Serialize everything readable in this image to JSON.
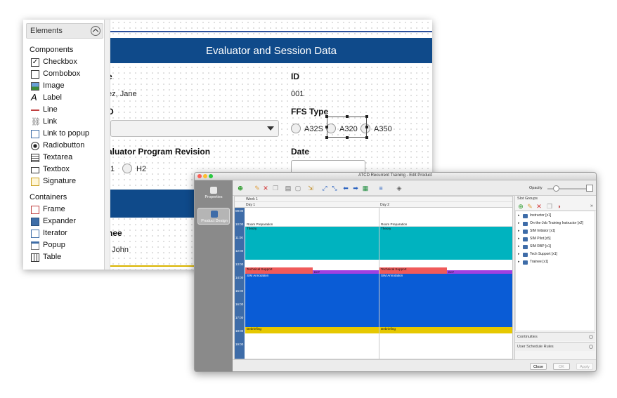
{
  "designer": {
    "palette": {
      "title": "Elements",
      "components_title": "Components",
      "components": [
        {
          "label": "Checkbox",
          "icon": "checkbox-icon"
        },
        {
          "label": "Combobox",
          "icon": "combobox-icon"
        },
        {
          "label": "Image",
          "icon": "image-icon"
        },
        {
          "label": "Label",
          "icon": "label-icon"
        },
        {
          "label": "Line",
          "icon": "line-icon"
        },
        {
          "label": "Link",
          "icon": "link-icon"
        },
        {
          "label": "Link to popup",
          "icon": "link-to-popup-icon"
        },
        {
          "label": "Radiobutton",
          "icon": "radiobutton-icon"
        },
        {
          "label": "Textarea",
          "icon": "textarea-icon"
        },
        {
          "label": "Textbox",
          "icon": "textbox-icon"
        },
        {
          "label": "Signature",
          "icon": "signature-icon"
        }
      ],
      "containers_title": "Containers",
      "containers": [
        {
          "label": "Frame",
          "icon": "frame-icon"
        },
        {
          "label": "Expander",
          "icon": "expander-icon"
        },
        {
          "label": "Iterator",
          "icon": "iterator-icon"
        },
        {
          "label": "Popup",
          "icon": "popup-icon"
        },
        {
          "label": "Table",
          "icon": "table-icon"
        }
      ]
    },
    "form": {
      "banner_title": "Evaluator and Session Data",
      "name_label_fragment": "e",
      "name_value_fragment": "ez, Jane",
      "id_label": "ID",
      "id_value": "001",
      "d_label_fragment": "D",
      "ffs_label": "FFS Type",
      "ffs_options": [
        "A32S",
        "A320",
        "A350"
      ],
      "program_label_fragment": "aluator Program Revision",
      "h_options_fragment": [
        "1",
        "H2"
      ],
      "date_label": "Date",
      "trainee_label_fragment": "nee",
      "trainee_value_fragment": ", John"
    },
    "colors": {
      "banner": "#0f4a8a"
    }
  },
  "atcd": {
    "window_title": "ATCD Recurrent Training - Edit Product",
    "nav": [
      {
        "label": "Properties",
        "icon": "properties-icon"
      },
      {
        "label": "Product Design",
        "icon": "product-design-icon"
      }
    ],
    "opacity_label": "Opacity",
    "timeline": {
      "week_label": "Week 1",
      "days": [
        "Day 1",
        "Day 2"
      ],
      "times": [
        "09:00",
        "10:00",
        "11:00",
        "12:00",
        "13:00",
        "14:00",
        "15:00",
        "16:00",
        "17:00",
        "18:00",
        "19:00"
      ],
      "blocks": [
        {
          "label": "Room Preparation",
          "color": "#ffffff"
        },
        {
          "label": "Theory",
          "color": "#00b3bf"
        },
        {
          "label": "Technical Support",
          "color": "#f05a5a"
        },
        {
          "label": "BCP",
          "color": "#a040e0"
        },
        {
          "label": "SIM Annotation",
          "color": "#0a5cd6"
        },
        {
          "label": "Debriefing",
          "color": "#e6c800"
        }
      ]
    },
    "slot_groups": {
      "title": "Slot Groups",
      "items": [
        "Instructor [x1]",
        "On-the-Job Training Instructor [x2]",
        "SIM Initiator [x1]",
        "SIM Pilot [x5]",
        "SIM RBP [x1]",
        "Tech Support [x1]",
        "Trainee [x1]"
      ],
      "continuities_label": "Continuities",
      "rules_label": "User Schedule Rules"
    },
    "footer": {
      "close": "Close",
      "ok": "OK",
      "apply": "Apply"
    }
  }
}
